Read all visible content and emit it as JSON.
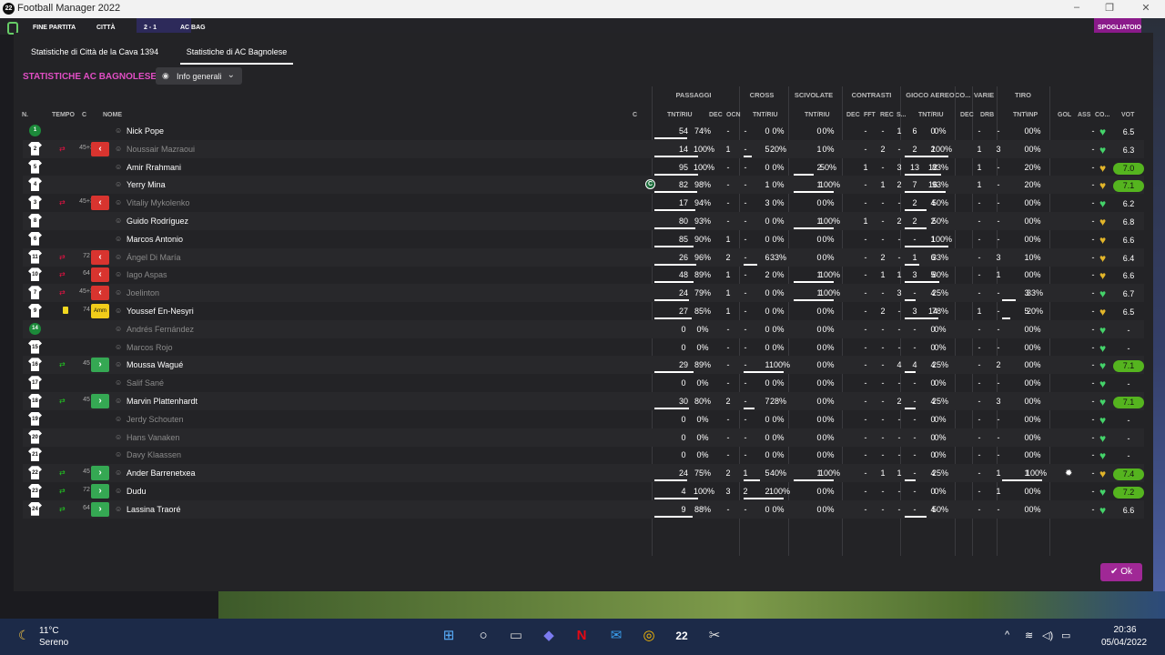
{
  "window": {
    "title": "Football Manager 2022",
    "logo": "22"
  },
  "game_top": {
    "left": "FINE PARTITA",
    "team1": "CITTÀ",
    "score": "2 - 1",
    "team2": "AC BAG",
    "right": "SPOGLIATOIO"
  },
  "tabs": [
    "Statistiche di Città de la Cava 1394",
    "Statistiche di AC Bagnolese"
  ],
  "heading": "STATISTICHE AC BAGNOLESE",
  "view_select": "Info generali",
  "groups": {
    "passaggi": "PASSAGGI",
    "cross": "CROSS",
    "scivolate": "SCIVOLATE",
    "contrasti": "CONTRASTI",
    "gioco_aereo": "GIOCO AEREO",
    "co": "CO...",
    "varie": "VARIE",
    "tiro": "TIRO"
  },
  "columns": {
    "n": "N.",
    "tempo": "TEMPO",
    "c": "C",
    "nome": "NOME",
    "cap": "C",
    "pass": "TNT/RIU",
    "dec": "DEC",
    "ocn": "OCN",
    "cross": "TNT/RIU",
    "sciv": "TNT/RIU",
    "cdec": "DEC",
    "fft": "FFT",
    "rec": "REC",
    "s": "S...",
    "aereo": "TNT/RIU",
    "adec": "DEC",
    "drb": "DRB",
    "tiro": "TNT\\INP",
    "gol": "GOL",
    "ass": "ASS",
    "co": "CO...",
    "vot": "VOT"
  },
  "players": [
    {
      "n": "1",
      "gk": true,
      "name": "Nick Pope",
      "dim": false,
      "p": "54",
      "pp": "74%",
      "pd": "-",
      "po": "-",
      "cr": "0",
      "crp": "0%",
      "sc": "0",
      "scp": "0%",
      "cd": "-",
      "cf": "-",
      "cre": "1",
      "cs": "6",
      "ae": "0",
      "aep": "0%",
      "ad": "-",
      "dr": "-",
      "ti": "0",
      "tip": "0%",
      "co": "-",
      "heart": "#44d36a",
      "vot": "6.5",
      "green": false
    },
    {
      "n": "2",
      "sub": "out",
      "min": "45+3",
      "name": "Noussair Mazraoui",
      "dim": true,
      "p": "14",
      "pp": "100%",
      "pd": "1",
      "po": "-",
      "cr": "5",
      "crp": "20%",
      "sc": "1",
      "scp": "0%",
      "cd": "-",
      "cf": "2",
      "cre": "-",
      "cs": "2",
      "ae": "2",
      "aep": "100%",
      "ad": "1",
      "dr": "3",
      "ti": "0",
      "tip": "0%",
      "co": "-",
      "heart": "#44d36a",
      "vot": "6.3",
      "green": false
    },
    {
      "n": "5",
      "name": "Amir Rrahmani",
      "dim": false,
      "p": "95",
      "pp": "100%",
      "pd": "-",
      "po": "-",
      "cr": "0",
      "crp": "0%",
      "sc": "2",
      "scp": "50%",
      "cd": "1",
      "cf": "-",
      "cre": "3",
      "cs": "13",
      "ae": "12",
      "aep": "83%",
      "ad": "1",
      "dr": "-",
      "ti": "2",
      "tip": "0%",
      "co": "-",
      "heart": "#e2b52a",
      "vot": "7.0",
      "green": true
    },
    {
      "n": "4",
      "cap": true,
      "name": "Yerry Mina",
      "dim": false,
      "p": "82",
      "pp": "98%",
      "pd": "-",
      "po": "-",
      "cr": "1",
      "crp": "0%",
      "sc": "1",
      "scp": "100%",
      "cd": "-",
      "cf": "1",
      "cre": "2",
      "cs": "7",
      "ae": "16",
      "aep": "93%",
      "ad": "1",
      "dr": "-",
      "ti": "2",
      "tip": "0%",
      "co": "-",
      "heart": "#e2b52a",
      "vot": "7.1",
      "green": true
    },
    {
      "n": "3",
      "sub": "out",
      "min": "45+3",
      "name": "Vitaliy Mykolenko",
      "dim": true,
      "p": "17",
      "pp": "94%",
      "pd": "-",
      "po": "-",
      "cr": "3",
      "crp": "0%",
      "sc": "0",
      "scp": "0%",
      "cd": "-",
      "cf": "-",
      "cre": "-",
      "cs": "2",
      "ae": "4",
      "aep": "50%",
      "ad": "-",
      "dr": "-",
      "ti": "0",
      "tip": "0%",
      "co": "-",
      "heart": "#44d36a",
      "vot": "6.2",
      "green": false
    },
    {
      "n": "8",
      "name": "Guido Rodríguez",
      "dim": false,
      "p": "80",
      "pp": "93%",
      "pd": "-",
      "po": "-",
      "cr": "0",
      "crp": "0%",
      "sc": "1",
      "scp": "100%",
      "cd": "1",
      "cf": "-",
      "cre": "2",
      "cs": "2",
      "ae": "2",
      "aep": "50%",
      "ad": "-",
      "dr": "-",
      "ti": "0",
      "tip": "0%",
      "co": "-",
      "heart": "#e2b52a",
      "vot": "6.8",
      "green": false
    },
    {
      "n": "6",
      "name": "Marcos Antonio",
      "dim": false,
      "p": "85",
      "pp": "90%",
      "pd": "1",
      "po": "-",
      "cr": "0",
      "crp": "0%",
      "sc": "0",
      "scp": "0%",
      "cd": "-",
      "cf": "-",
      "cre": "-",
      "cs": "-",
      "ae": "1",
      "aep": "100%",
      "ad": "-",
      "dr": "-",
      "ti": "0",
      "tip": "0%",
      "co": "-",
      "heart": "#e2b52a",
      "vot": "6.6",
      "green": false
    },
    {
      "n": "11",
      "sub": "out",
      "min": "72",
      "name": "Ángel Di María",
      "dim": true,
      "p": "26",
      "pp": "96%",
      "pd": "2",
      "po": "-",
      "cr": "6",
      "crp": "33%",
      "sc": "0",
      "scp": "0%",
      "cd": "-",
      "cf": "2",
      "cre": "-",
      "cs": "1",
      "ae": "6",
      "aep": "33%",
      "ad": "-",
      "dr": "3",
      "ti": "1",
      "tip": "0%",
      "co": "-",
      "heart": "#e2b52a",
      "vot": "6.4",
      "green": false
    },
    {
      "n": "10",
      "sub": "out",
      "min": "64",
      "name": "Iago Aspas",
      "dim": true,
      "p": "48",
      "pp": "89%",
      "pd": "1",
      "po": "-",
      "cr": "2",
      "crp": "0%",
      "sc": "1",
      "scp": "100%",
      "cd": "-",
      "cf": "1",
      "cre": "1",
      "cs": "3",
      "ae": "5",
      "aep": "80%",
      "ad": "-",
      "dr": "1",
      "ti": "0",
      "tip": "0%",
      "co": "-",
      "heart": "#e2b52a",
      "vot": "6.6",
      "green": false
    },
    {
      "n": "7",
      "sub": "out",
      "min": "45+3",
      "name": "Joelinton",
      "dim": true,
      "p": "24",
      "pp": "79%",
      "pd": "1",
      "po": "-",
      "cr": "0",
      "crp": "0%",
      "sc": "1",
      "scp": "100%",
      "cd": "-",
      "cf": "-",
      "cre": "3",
      "cs": "-",
      "ae": "4",
      "aep": "25%",
      "ad": "-",
      "dr": "-",
      "ti": "3",
      "tip": "33%",
      "co": "-",
      "heart": "#44d36a",
      "vot": "6.7",
      "green": false
    },
    {
      "n": "9",
      "yellow": true,
      "min": "74",
      "amm": "Amm",
      "name": "Youssef En-Nesyri",
      "dim": false,
      "p": "27",
      "pp": "85%",
      "pd": "1",
      "po": "-",
      "cr": "0",
      "crp": "0%",
      "sc": "0",
      "scp": "0%",
      "cd": "-",
      "cf": "2",
      "cre": "-",
      "cs": "3",
      "ae": "14",
      "aep": "78%",
      "ad": "1",
      "dr": "-",
      "ti": "5",
      "tip": "20%",
      "co": "-",
      "heart": "#e2b52a",
      "vot": "6.5",
      "green": false
    },
    {
      "n": "14",
      "gk": true,
      "name": "Andrés Fernández",
      "dim": true,
      "p": "0",
      "pp": "0%",
      "pd": "-",
      "po": "-",
      "cr": "0",
      "crp": "0%",
      "sc": "0",
      "scp": "0%",
      "cd": "-",
      "cf": "-",
      "cre": "-",
      "cs": "-",
      "ae": "0",
      "aep": "0%",
      "ad": "-",
      "dr": "-",
      "ti": "0",
      "tip": "0%",
      "co": "-",
      "heart": "#44d36a",
      "vot": "-",
      "green": false
    },
    {
      "n": "15",
      "name": "Marcos Rojo",
      "dim": true,
      "p": "0",
      "pp": "0%",
      "pd": "-",
      "po": "-",
      "cr": "0",
      "crp": "0%",
      "sc": "0",
      "scp": "0%",
      "cd": "-",
      "cf": "-",
      "cre": "-",
      "cs": "-",
      "ae": "0",
      "aep": "0%",
      "ad": "-",
      "dr": "-",
      "ti": "0",
      "tip": "0%",
      "co": "-",
      "heart": "#44d36a",
      "vot": "-",
      "green": false
    },
    {
      "n": "16",
      "sub": "in",
      "min": "45",
      "name": "Moussa Wagué",
      "dim": false,
      "p": "29",
      "pp": "89%",
      "pd": "-",
      "po": "-",
      "cr": "1",
      "crp": "100%",
      "sc": "0",
      "scp": "0%",
      "cd": "-",
      "cf": "-",
      "cre": "4",
      "cs": "4",
      "ae": "4",
      "aep": "25%",
      "ad": "-",
      "dr": "2",
      "ti": "0",
      "tip": "0%",
      "co": "-",
      "heart": "#44d36a",
      "vot": "7.1",
      "green": true
    },
    {
      "n": "17",
      "name": "Salif Sané",
      "dim": true,
      "p": "0",
      "pp": "0%",
      "pd": "-",
      "po": "-",
      "cr": "0",
      "crp": "0%",
      "sc": "0",
      "scp": "0%",
      "cd": "-",
      "cf": "-",
      "cre": "-",
      "cs": "-",
      "ae": "0",
      "aep": "0%",
      "ad": "-",
      "dr": "-",
      "ti": "0",
      "tip": "0%",
      "co": "-",
      "heart": "#44d36a",
      "vot": "-",
      "green": false
    },
    {
      "n": "18",
      "sub": "in",
      "min": "45",
      "name": "Marvin Plattenhardt",
      "dim": false,
      "p": "30",
      "pp": "80%",
      "pd": "2",
      "po": "-",
      "cr": "7",
      "crp": "28%",
      "sc": "0",
      "scp": "0%",
      "cd": "-",
      "cf": "-",
      "cre": "2",
      "cs": "-",
      "ae": "4",
      "aep": "25%",
      "ad": "-",
      "dr": "3",
      "ti": "0",
      "tip": "0%",
      "co": "-",
      "heart": "#44d36a",
      "vot": "7.1",
      "green": true
    },
    {
      "n": "19",
      "name": "Jerdy Schouten",
      "dim": true,
      "p": "0",
      "pp": "0%",
      "pd": "-",
      "po": "-",
      "cr": "0",
      "crp": "0%",
      "sc": "0",
      "scp": "0%",
      "cd": "-",
      "cf": "-",
      "cre": "-",
      "cs": "-",
      "ae": "0",
      "aep": "0%",
      "ad": "-",
      "dr": "-",
      "ti": "0",
      "tip": "0%",
      "co": "-",
      "heart": "#44d36a",
      "vot": "-",
      "green": false
    },
    {
      "n": "20",
      "name": "Hans Vanaken",
      "dim": true,
      "p": "0",
      "pp": "0%",
      "pd": "-",
      "po": "-",
      "cr": "0",
      "crp": "0%",
      "sc": "0",
      "scp": "0%",
      "cd": "-",
      "cf": "-",
      "cre": "-",
      "cs": "-",
      "ae": "0",
      "aep": "0%",
      "ad": "-",
      "dr": "-",
      "ti": "0",
      "tip": "0%",
      "co": "-",
      "heart": "#44d36a",
      "vot": "-",
      "green": false
    },
    {
      "n": "21",
      "name": "Davy Klaassen",
      "dim": true,
      "p": "0",
      "pp": "0%",
      "pd": "-",
      "po": "-",
      "cr": "0",
      "crp": "0%",
      "sc": "0",
      "scp": "0%",
      "cd": "-",
      "cf": "-",
      "cre": "-",
      "cs": "-",
      "ae": "0",
      "aep": "0%",
      "ad": "-",
      "dr": "-",
      "ti": "0",
      "tip": "0%",
      "co": "-",
      "heart": "#44d36a",
      "vot": "-",
      "green": false
    },
    {
      "n": "22",
      "sub": "in",
      "min": "45",
      "name": "Ander Barrenetxea",
      "dim": false,
      "p": "24",
      "pp": "75%",
      "pd": "2",
      "po": "1",
      "cr": "5",
      "crp": "40%",
      "sc": "1",
      "scp": "100%",
      "cd": "-",
      "cf": "1",
      "cre": "1",
      "cs": "-",
      "ae": "4",
      "aep": "25%",
      "ad": "-",
      "dr": "1",
      "ti": "1",
      "tip": "100%",
      "co": "-",
      "gear": true,
      "heart": "#e2b52a",
      "vot": "7.4",
      "green": true
    },
    {
      "n": "23",
      "sub": "in",
      "min": "72",
      "name": "Dudu",
      "dim": false,
      "p": "4",
      "pp": "100%",
      "pd": "3",
      "po": "2",
      "cr": "2",
      "crp": "100%",
      "sc": "0",
      "scp": "0%",
      "cd": "-",
      "cf": "-",
      "cre": "-",
      "cs": "-",
      "ae": "0",
      "aep": "0%",
      "ad": "-",
      "dr": "1",
      "ti": "0",
      "tip": "0%",
      "co": "-",
      "heart": "#44d36a",
      "vot": "7.2",
      "green": true
    },
    {
      "n": "24",
      "sub": "in",
      "min": "64",
      "name": "Lassina Traoré",
      "dim": false,
      "p": "9",
      "pp": "88%",
      "pd": "-",
      "po": "-",
      "cr": "0",
      "crp": "0%",
      "sc": "0",
      "scp": "0%",
      "cd": "-",
      "cf": "-",
      "cre": "-",
      "cs": "-",
      "ae": "4",
      "aep": "50%",
      "ad": "-",
      "dr": "-",
      "ti": "0",
      "tip": "0%",
      "co": "-",
      "heart": "#44d36a",
      "vot": "6.6",
      "green": false
    }
  ],
  "ok_button": "Ok",
  "taskbar": {
    "temp": "11°C",
    "condition": "Sereno",
    "time": "20:36",
    "date": "05/04/2022"
  }
}
